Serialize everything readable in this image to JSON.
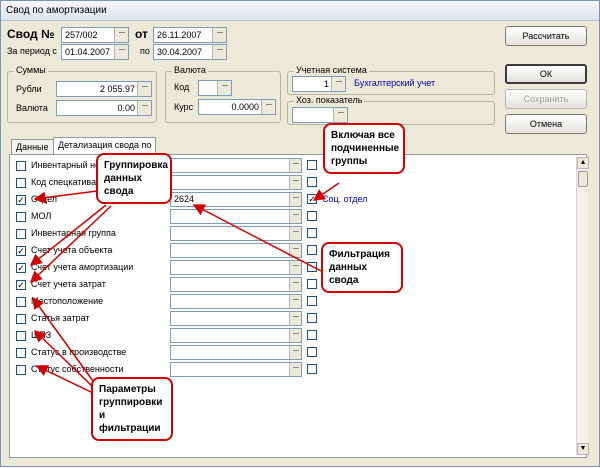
{
  "window": {
    "title": "Свод по амортизации"
  },
  "header": {
    "svod_label": "Свод №",
    "svod_value": "257/002",
    "ot_label": "от",
    "ot_value": "26.11.2007",
    "period_label": "За период с",
    "period_from": "01.04.2007",
    "po_label": "по",
    "period_to": "30.04.2007"
  },
  "sums": {
    "title": "Суммы",
    "rubles_label": "Рубли",
    "rubles_value": "2 055.97",
    "currency_label": "Валюта",
    "currency_value": "0.00"
  },
  "currency_group": {
    "title": "Валюта",
    "code_label": "Код",
    "code_value": "",
    "rate_label": "Курс",
    "rate_value": "0.0000"
  },
  "accounting": {
    "title": "Учетная система",
    "number": "1",
    "name": "Бухгалтерский учет"
  },
  "indicator": {
    "title": "Хоз. показатель",
    "value": ""
  },
  "buttons": {
    "calculate": "Рассчитать",
    "ok": "ОК",
    "save": "Сохранить",
    "cancel": "Отмена"
  },
  "tabs": [
    "Данные",
    "Детализация свода по"
  ],
  "rows": [
    {
      "label": "Инвентарный номер",
      "checked": false,
      "value": "",
      "include_sub": false,
      "note": ""
    },
    {
      "label": "Код спецкатива",
      "checked": false,
      "value": "",
      "include_sub": false,
      "note": ""
    },
    {
      "label": "Отдел",
      "checked": true,
      "value": "2624",
      "include_sub": true,
      "note": "Соц. отдел"
    },
    {
      "label": "МОЛ",
      "checked": false,
      "value": "",
      "include_sub": false,
      "note": ""
    },
    {
      "label": "Инвентарная группа",
      "checked": false,
      "value": "",
      "include_sub": false,
      "note": ""
    },
    {
      "label": "Счет учета объекта",
      "checked": true,
      "value": "",
      "include_sub": false,
      "note": ""
    },
    {
      "label": "Счет учета амортизации",
      "checked": true,
      "value": "",
      "include_sub": false,
      "note": ""
    },
    {
      "label": "Счет учета затрат",
      "checked": true,
      "value": "",
      "include_sub": false,
      "note": ""
    },
    {
      "label": "Местоположение",
      "checked": false,
      "value": "",
      "include_sub": false,
      "note": ""
    },
    {
      "label": "Статья затрат",
      "checked": false,
      "value": "",
      "include_sub": false,
      "note": ""
    },
    {
      "label": "ШПЗ",
      "checked": false,
      "value": "",
      "include_sub": false,
      "note": ""
    },
    {
      "label": "Статус в производстве",
      "checked": false,
      "value": "",
      "include_sub": false,
      "note": ""
    },
    {
      "label": "Статус собственности",
      "checked": false,
      "value": "",
      "include_sub": false,
      "note": ""
    }
  ],
  "callouts": {
    "grouping": "Группировка данных свода",
    "include_sub": "Включая все подчиненные группы",
    "filtering": "Фильтрация данных свода",
    "params": "Параметры группировки и фильтрации"
  },
  "colors": {
    "callout_border": "#d40000",
    "link": "#0000c0"
  },
  "icons": {
    "lookup": "dots-icon",
    "check": "check-icon"
  }
}
